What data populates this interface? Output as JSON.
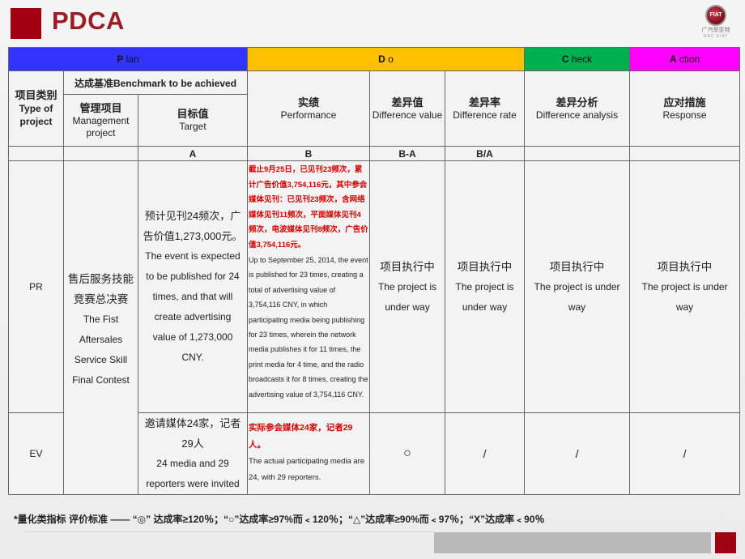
{
  "header": {
    "title": "PDCA",
    "brand_logo": "FIAT",
    "brand_text": "广汽菲亚特",
    "brand_sub": "GAC FIAT"
  },
  "phases": {
    "plan": {
      "initial": "P",
      "rest": " lan",
      "color": "#3333ff"
    },
    "do": {
      "initial": "D",
      "rest": " o",
      "color": "#ffc000"
    },
    "check": {
      "initial": "C",
      "rest": " heck",
      "color": "#00b050"
    },
    "action": {
      "initial": "A",
      "rest": " ction",
      "color": "#ff00ff"
    }
  },
  "columns": {
    "type": {
      "cn": "项目类别",
      "en1": "Type of",
      "en2": "project"
    },
    "benchmark": "达成基准Benchmark to be achieved",
    "management": {
      "cn": "管理项目",
      "en1": "Management",
      "en2": "project"
    },
    "target": {
      "cn": "目标值",
      "en": "Target",
      "code": "A"
    },
    "performance": {
      "cn": "实绩",
      "en": "Performance",
      "code": "B"
    },
    "diff_value": {
      "cn": "差异值",
      "en": "Difference value",
      "code": "B-A"
    },
    "diff_rate": {
      "cn": "差异率",
      "en": "Difference rate",
      "code": "B/A"
    },
    "diff_analysis": {
      "cn": "差异分析",
      "en": "Difference analysis"
    },
    "response": {
      "cn": "应对措施",
      "en": "Response"
    }
  },
  "management_project": {
    "cn1": "售后服务技能",
    "cn2": "竞赛总决赛",
    "en1": "The Fist",
    "en2": "Aftersales",
    "en3": "Service Skill",
    "en4": "Final Contest"
  },
  "rows": [
    {
      "type": "PR",
      "target_cn1": "预计见刊24频次，广",
      "target_cn2": "告价值1,273,000元。",
      "target_en": [
        "The event is expected",
        "to be published for 24",
        "times, and that will",
        "create advertising",
        "value of 1,273,000",
        "CNY."
      ],
      "performance_cn": "截止9月25日，已见刊23频次，累计广告价值3,754,116元，其中参会媒体见刊：已见刊23频次，含网络媒体见刊11频次，平面媒体见刊4频次，电波媒体见刊8频次，广告价值3,754,116元。",
      "performance_en": "Up to September 25, 2014, the event is published for 23 times, creating a total of advertising value of 3,754,116 CNY, in which participating media being publishing for 23 times, wherein the network media publishes it for 11 times, the print media for 4 time, and the radio broadcasts it for 8 times, creating the advertising value of 3,754,116 CNY.",
      "diff_value": {
        "cn": "项目执行中",
        "en1": "The project is",
        "en2": "under way"
      },
      "diff_rate": {
        "cn": "项目执行中",
        "en1": "The project is",
        "en2": "under way"
      },
      "diff_analysis": {
        "cn": "项目执行中",
        "en1": "The project is under",
        "en2": "way"
      },
      "response": {
        "cn": "项目执行中",
        "en1": "The project is under",
        "en2": "way"
      }
    },
    {
      "type": "EV",
      "target_cn1": "邀请媒体24家，记者",
      "target_cn2": "29人",
      "target_en": [
        "24 media and 29",
        "reporters were invited"
      ],
      "performance_cn": "实际参会媒体24家，记者29人。",
      "performance_en": "The actual participating media are 24, with 29 reporters.",
      "diff_value": "○",
      "diff_rate": "/",
      "diff_analysis": "/",
      "response": "/"
    }
  ],
  "footnote": "*量化类指标 评价标准 —— “◎” 达成率≥120％；“○”达成率≥97%而﹤120％；“△”达成率≥90%而﹤97％；“X”达成率﹤90％"
}
